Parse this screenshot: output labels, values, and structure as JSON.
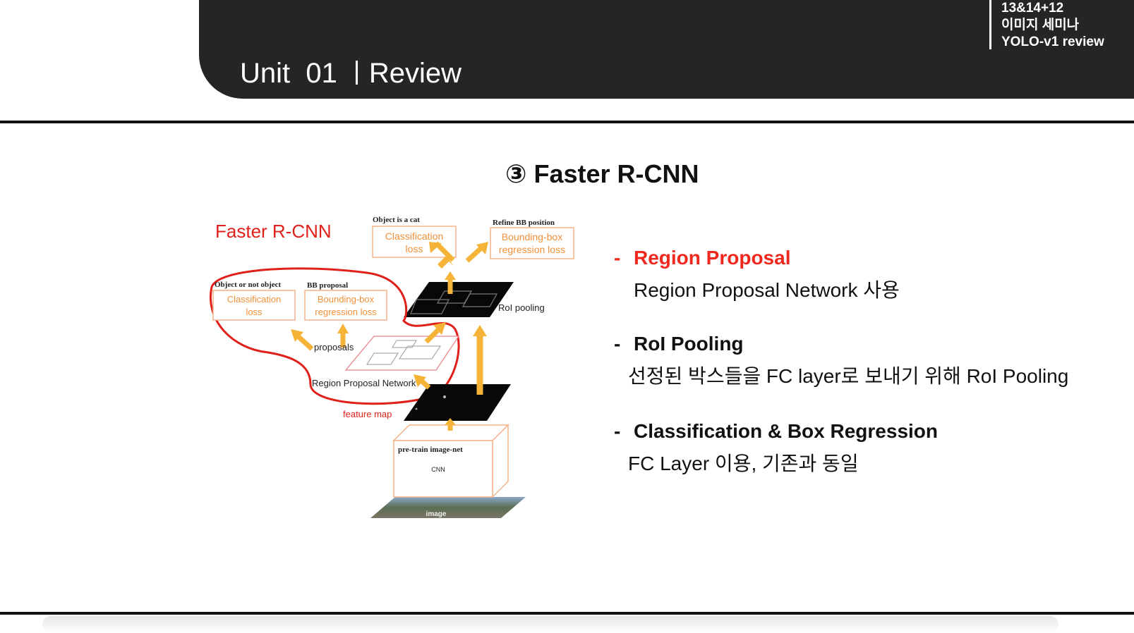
{
  "header": {
    "unit_label": "Unit  01",
    "section": "Review",
    "tag_lines": [
      "13&14+12",
      "이미지 세미나",
      "YOLO-v1 review"
    ]
  },
  "slide": {
    "title": "③ Faster R-CNN"
  },
  "diagram": {
    "title": "Faster R-CNN",
    "top_cls_caption": "Object is a cat",
    "top_cls_box": [
      "Classification",
      "loss"
    ],
    "top_bb_caption": "Refine BB position",
    "top_bb_box": [
      "Bounding-box",
      "regression loss"
    ],
    "rpn_cls_caption": "Object or not object",
    "rpn_cls_box": [
      "Classification",
      "loss"
    ],
    "rpn_bb_caption": "BB proposal",
    "rpn_bb_box": [
      "Bounding-box",
      "regression loss"
    ],
    "roi_pooling": "RoI pooling",
    "proposals": "proposals",
    "rpn_label": "Region Proposal Network",
    "feature_map": "feature map",
    "cnn_caption": "pre-train image-net",
    "cnn_label": "CNN",
    "image_label": "image",
    "colors": {
      "red": "#e0201a",
      "orange": "#f0a030",
      "box_border": "#f3b48a",
      "box_text": "#f0903a"
    }
  },
  "bullets": [
    {
      "dash": "-",
      "heading": "Region Proposal",
      "body": "Region Proposal Network 사용",
      "heading_color": "#f0281e"
    },
    {
      "dash": "-",
      "heading": "RoI Pooling",
      "body": "선정된 박스들을 FC layer로 보내기 위해  RoI Pooling"
    },
    {
      "dash": "-",
      "heading": "Classification & Box Regression",
      "body": "FC Layer 이용, 기존과 동일"
    }
  ]
}
